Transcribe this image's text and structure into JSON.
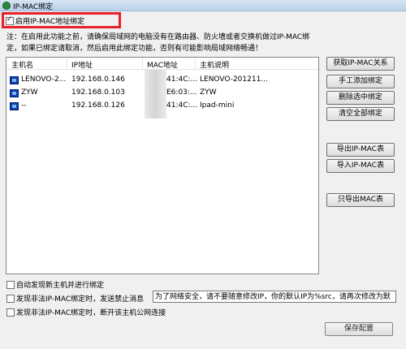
{
  "window": {
    "title": "IP-MAC绑定"
  },
  "enable_binding": {
    "label": "启用IP-MAC地址绑定",
    "checked": true,
    "highlight_color": "#e8202a"
  },
  "note": {
    "line1": "注：在启用此功能之前，请确保局域网的电脑没有在路由器、防火墙或者交换机做过IP-MAC绑",
    "line2": "定，如果已绑定请取消，然后启用此绑定功能，否则有可能影响局域网络畅通！"
  },
  "table": {
    "headers": [
      "主机名",
      "IP地址",
      "MAC地址",
      "主机说明"
    ],
    "rows": [
      {
        "host": "LENOVO-2...",
        "ip": "192.168.0.146",
        "mac": "41:4C:...",
        "desc": "LENOVO-201211..."
      },
      {
        "host": "ZYW",
        "ip": "192.168.0.103",
        "mac": "E6:03:...",
        "desc": "ZYW"
      },
      {
        "host": "--",
        "ip": "192.168.0.126",
        "mac": "41:4C:...",
        "desc": "Ipad-mini"
      }
    ]
  },
  "buttons": {
    "get_relation": "获取IP-MAC关系",
    "manual_add": "手工添加绑定",
    "delete_selected": "删除选中绑定",
    "clear_all": "清空全部绑定",
    "export": "导出IP-MAC表",
    "import": "导入IP-MAC表",
    "export_mac_only": "只导出MAC表",
    "save": "保存配置"
  },
  "options": {
    "auto_discover": {
      "label": "自动发现新主机并进行绑定",
      "checked": false
    },
    "illegal_send_msg": {
      "label": "发现非法IP-MAC绑定时，发送禁止消息",
      "checked": false
    },
    "message_text": "为了网络安全，请不要随意修改IP，你的默认IP为%src，请再次修改为默",
    "illegal_disconnect": {
      "label": "发现非法IP-MAC绑定时，断开该主机公网连接",
      "checked": false
    }
  }
}
